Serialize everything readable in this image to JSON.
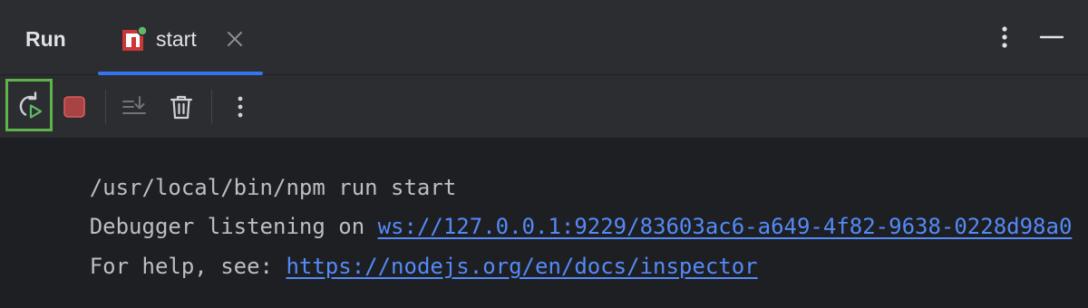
{
  "header": {
    "title": "Run",
    "tab": {
      "label": "start",
      "icon": "npm-icon"
    },
    "actions": [
      "more-options-icon",
      "minimize-icon"
    ]
  },
  "toolbar": {
    "buttons": [
      "rerun-icon",
      "stop-icon",
      "scroll-to-end-icon",
      "clear-all-icon",
      "more-options-icon"
    ]
  },
  "console": {
    "line1": "/usr/local/bin/npm run start",
    "line2_prefix": "Debugger listening on ",
    "line2_link": "ws://127.0.0.1:9229/83603ac6-a649-4f82-9638-0228d98a0",
    "line3_prefix": "For help, see: ",
    "line3_link": "https://nodejs.org/en/docs/inspector"
  },
  "colors": {
    "background": "#1e1f22",
    "panel": "#2b2d30",
    "accent": "#3574f0",
    "link": "#548af7",
    "highlight": "#5eb44a",
    "stop": "#c94f4f",
    "npm_red": "#cb3837",
    "badge_green": "#5fb865"
  }
}
